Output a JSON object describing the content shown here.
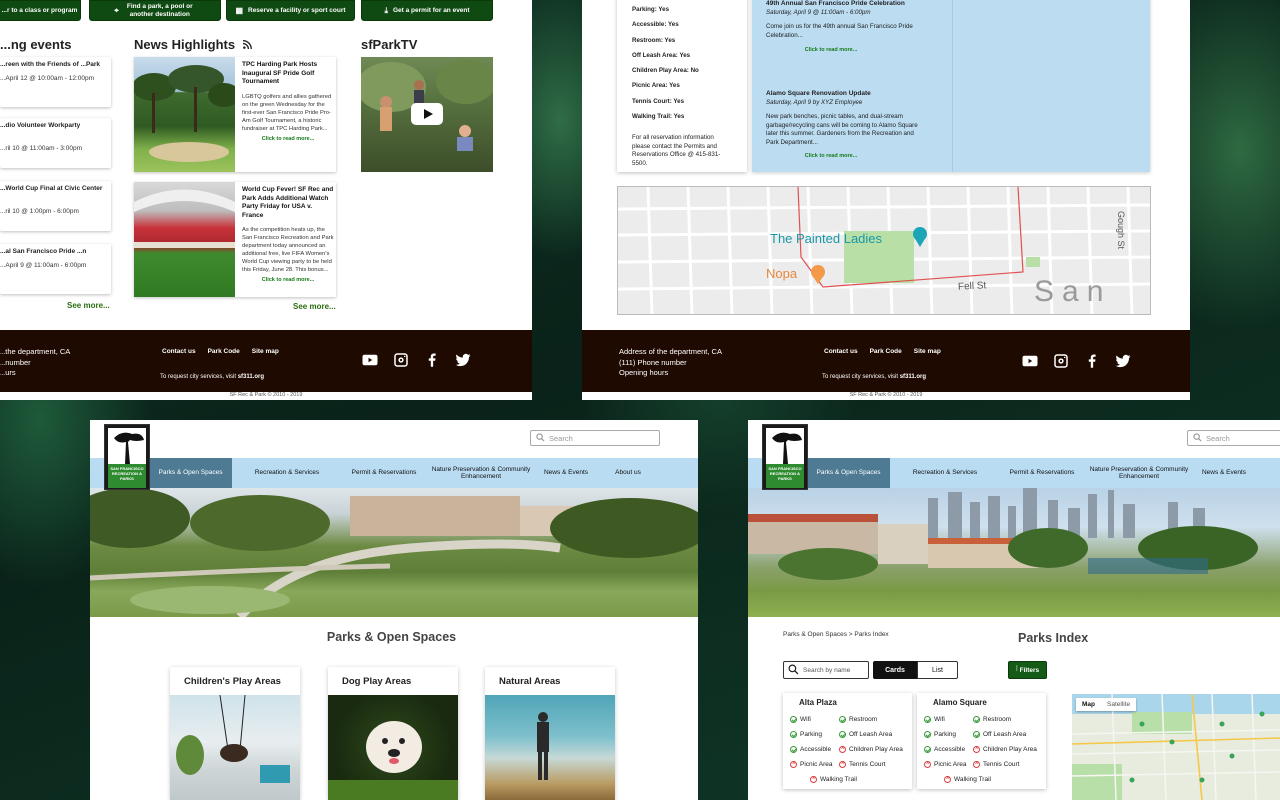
{
  "panel1": {
    "top_buttons": [
      "...r to a class or program",
      "Find a park, a pool or another destination",
      "Reserve a facility or sport court",
      "Get a permit for an event"
    ],
    "events_heading": "...ng events",
    "events": [
      {
        "title": "...reen with the Friends of ...Park",
        "date": "...April 12 @ 10:00am - 12:00pm"
      },
      {
        "title": "...dio Volunteer Workparty",
        "date": "...ril 10 @ 11:00am - 3:00pm"
      },
      {
        "title": "...World Cup Final at Civic Center",
        "date": "...ril 10 @ 1:00pm - 6:00pm"
      },
      {
        "title": "...al San Francisco Pride ...n",
        "date": "...April 9 @ 11:00am - 6:00pm"
      }
    ],
    "events_see_more": "See more...",
    "news_heading": "News Highlights",
    "news": [
      {
        "title": "TPC Harding Park Hosts Inaugural SF Pride Golf Tournament",
        "body": "LGBTQ golfers and allies gathered on the green Wednesday for the first-ever San Francisco Pride Pro-Am Golf Tournament, a historic fundraiser at TPC Harding Park...",
        "more": "Click to read more..."
      },
      {
        "title": "World Cup Fever! SF Rec and Park Adds Additional Watch Party Friday for USA v. France",
        "body": "As the competition heats up, the San Francisco Recreation and Park department today announced an additional free, live FIFA Women's World Cup viewing party to be held this Friday, June 28. This bonus...",
        "more": "Click to read more..."
      }
    ],
    "news_see_more": "See more...",
    "tv_heading": "sfParkTV",
    "footer_address": [
      "...the department, CA",
      "...number",
      "...urs"
    ],
    "footer_links": [
      "Contact us",
      "Park Code",
      "Site map"
    ],
    "footer_request_prefix": "To request city services, visit ",
    "footer_request_link": "sf311.org",
    "copyright": "SF Rec & Park © 2010 - 2019"
  },
  "panel2": {
    "amenities": [
      "Parking: Yes",
      "Accessible: Yes",
      "Restroom: Yes",
      "Off Leash Area: Yes",
      "Children Play Area: No",
      "Picnic Area: Yes",
      "Tennis Court: Yes",
      "Walking Trail: Yes"
    ],
    "reservation_info": "For all reservation information please contact the Permits and Reservations Office @ 415-831-5500.",
    "posts": [
      {
        "title": "49th Annual San Francisco Pride Celebration",
        "date": "Saturday, April 9 @ 11:00am - 6:00pm",
        "body": "Come join us for the 49th annual San Francisco Pride Celebration...",
        "more": "Click to read more..."
      },
      {
        "title": "Alamo Square Renovation Update",
        "date": "Saturday, April 9 by XYZ Employee",
        "body": "New park benches, picnic tables, and dual-stream garbage/recycling cans will be coming to Alamo Square later this summer. Gardeners from the Recreation and Park Department...",
        "more": "Click to read more..."
      }
    ],
    "map_labels": {
      "painted_ladies": "The Painted Ladies",
      "nopa": "Nopa",
      "fell": "Fell St",
      "gough": "Gough St",
      "san": "San F"
    },
    "footer_address": [
      "Address of the department, CA",
      "(111) Phone number",
      "Opening hours"
    ],
    "footer_links": [
      "Contact us",
      "Park Code",
      "Site map"
    ],
    "footer_request_prefix": "To request city services, visit ",
    "footer_request_link": "sf311.org",
    "copyright": "SF Rec & Park © 2010 - 2019"
  },
  "panel3": {
    "search_placeholder": "Search",
    "nav": [
      "Parks & Open Spaces",
      "Recreation & Services",
      "Permit & Reservations",
      "Nature Preservation & Community Enhancement",
      "News & Events",
      "About us"
    ],
    "logo_text": "SAN FRANCISCO RECREATION & PARKS",
    "page_title": "Parks & Open Spaces",
    "categories": [
      "Children's Play Areas",
      "Dog Play Areas",
      "Natural Areas"
    ]
  },
  "panel4": {
    "search_placeholder": "Search",
    "nav": [
      "Parks & Open Spaces",
      "Recreation & Services",
      "Permit & Reservations",
      "Nature Preservation & Community Enhancement",
      "News & Events"
    ],
    "logo_text": "SAN FRANCISCO RECREATION & PARKS",
    "breadcrumb": "Parks & Open Spaces > Parks Index",
    "page_title": "Parks Index",
    "search_name_placeholder": "Search by name",
    "view_cards": "Cards",
    "view_list": "List",
    "filters": "Filters",
    "parks": [
      {
        "name": "Alta Plaza",
        "left": [
          "Wifi",
          "Parking",
          "Accessible",
          "Picnic Area"
        ],
        "right": [
          "Restroom",
          "Off Leash Area",
          "Children Play Area",
          "Tennis Court"
        ],
        "bottom": "Walking Trail"
      },
      {
        "name": "Alamo Square",
        "left": [
          "Wifi",
          "Parking",
          "Accessible",
          "Picnic Area"
        ],
        "right": [
          "Restroom",
          "Off Leash Area",
          "Children Play Area",
          "Tennis Court"
        ],
        "bottom": "Walking Trail"
      }
    ],
    "map_tabs": [
      "Map",
      "Satellite"
    ]
  }
}
